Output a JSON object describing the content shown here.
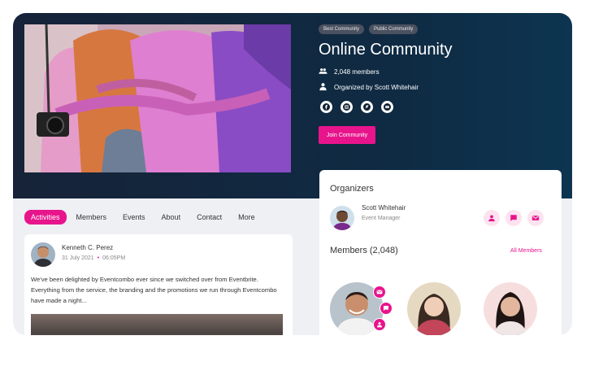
{
  "community": {
    "tags": [
      "Best Community",
      "Public Community"
    ],
    "title": "Online Community",
    "members_text": "2,048 members",
    "organized_by": "Organized by Scott Whitehair",
    "join_label": "Join Community",
    "socials": [
      "facebook-icon",
      "instagram-icon",
      "twitter-icon",
      "youtube-icon"
    ]
  },
  "tabs": [
    "Activities",
    "Members",
    "Events",
    "About",
    "Contact",
    "More"
  ],
  "post": {
    "author": "Kenneth C. Perez",
    "date": "31 July 2021",
    "time": "06:05PM",
    "text": "We've been delighted by Eventcombo ever since we switched over from Eventbrite. Everything from the service, the branding and the promotions we run through Eventcombo have made a night..."
  },
  "organizers": {
    "heading": "Organizers",
    "name": "Scott Whitehair",
    "role": "Event Manager"
  },
  "members": {
    "heading": "Members (2,048)",
    "all_label": "All Members"
  },
  "colors": {
    "accent": "#e8148c",
    "hero_dark": "#162338"
  }
}
